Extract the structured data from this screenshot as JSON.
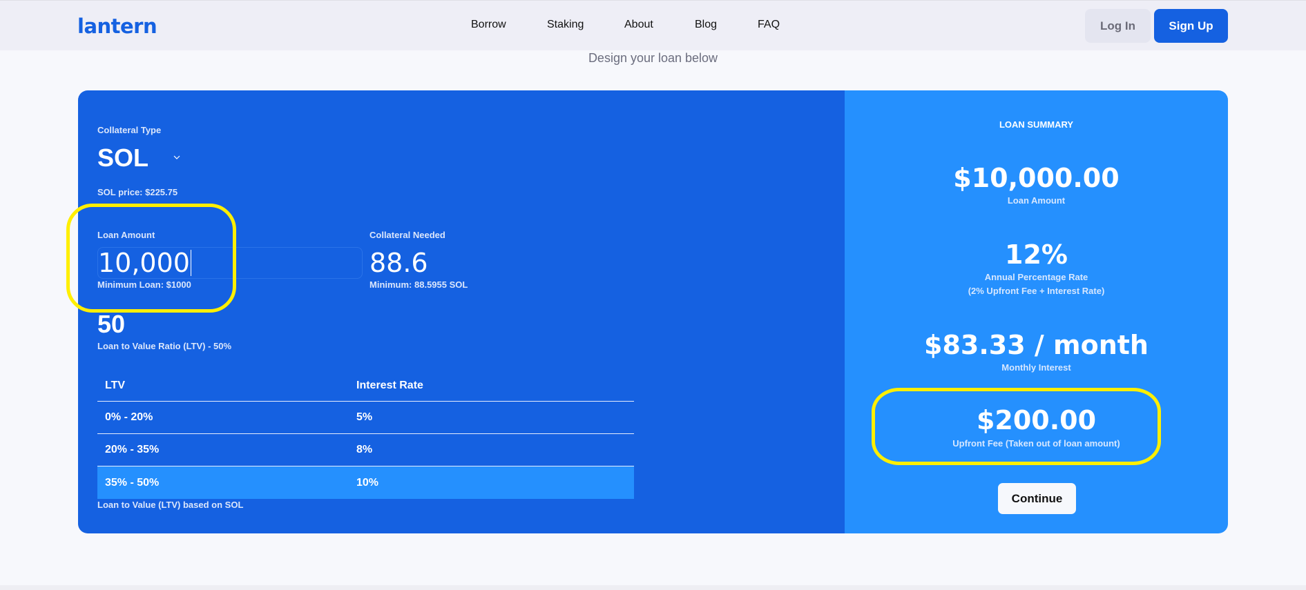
{
  "header": {
    "logo": "lantern",
    "nav": [
      "Borrow",
      "Staking",
      "About",
      "Blog",
      "FAQ"
    ],
    "login_label": "Log In",
    "signup_label": "Sign Up"
  },
  "page": {
    "subtitle": "Design your loan below"
  },
  "form": {
    "collateral_type_label": "Collateral Type",
    "collateral_type_value": "SOL",
    "price_text": "SOL price: $225.75",
    "loan_amount_label": "Loan Amount",
    "loan_amount_value": "10,000",
    "minimum_loan_text": "Minimum Loan: $1000",
    "collateral_needed_label": "Collateral Needed",
    "collateral_needed_value": "88.6",
    "collateral_minimum_text": "Minimum: 88.5955 SOL",
    "ltv_value": "50",
    "ltv_label": "Loan to Value Ratio (LTV) - 50%",
    "ltv_footnote": "Loan to Value (LTV) based on SOL"
  },
  "ltv_table": {
    "headers": [
      "LTV",
      "Interest Rate"
    ],
    "rows": [
      {
        "ltv": "0% - 20%",
        "rate": "5%"
      },
      {
        "ltv": "20% - 35%",
        "rate": "8%"
      },
      {
        "ltv": "35% - 50%",
        "rate": "10%"
      }
    ],
    "active_row_index": 2
  },
  "summary": {
    "title": "LOAN SUMMARY",
    "loan_amount_value": "$10,000.00",
    "loan_amount_label": "Loan Amount",
    "apr_value": "12%",
    "apr_label": "Annual Percentage Rate",
    "apr_sublabel": "(2% Upfront Fee + Interest Rate)",
    "monthly_value": "$83.33 / month",
    "monthly_label": "Monthly Interest",
    "fee_value": "$200.00",
    "fee_label": "Upfront Fee (Taken out of loan amount)",
    "continue_label": "Continue"
  },
  "colors": {
    "brand": "#1561e1",
    "summary_bg": "#2590fe",
    "highlight": "#ffef00"
  }
}
